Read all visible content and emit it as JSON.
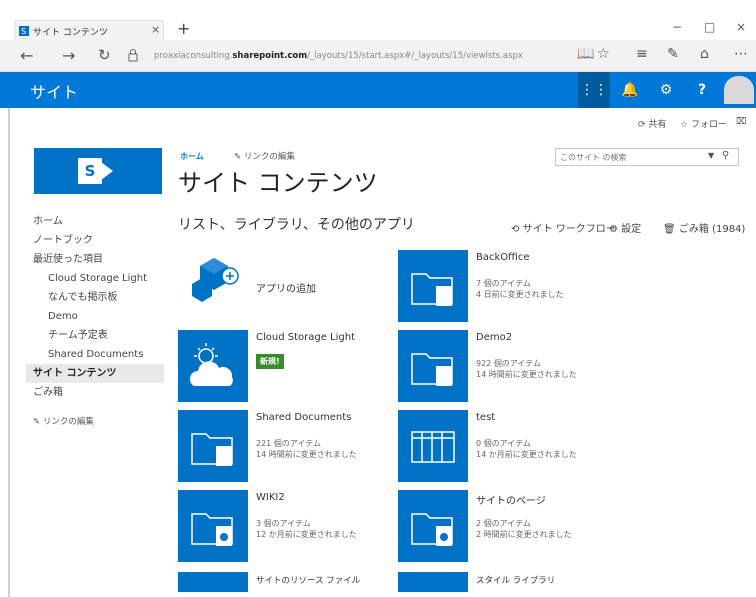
{
  "browser": {
    "tab_title": "サイト コンテンツ",
    "tab_close": "×",
    "new_tab": "+",
    "url_prefix": "proaxiaconsulting.",
    "url_host": "sharepoint.com",
    "url_path": "/_layouts/15/start.aspx#/_layouts/15/viewlsts.aspx",
    "win_minimize": "−",
    "win_maximize": "□",
    "win_close": "×"
  },
  "suitebar": {
    "title": "サイト",
    "help_label": "?"
  },
  "ribbon": {
    "share_label": "共有",
    "follow_label": "フォロー"
  },
  "header": {
    "breadcrumb_home": "ホーム",
    "breadcrumb_edit_links": "リンクの編集",
    "page_title": "サイト コンテンツ",
    "search_placeholder": "このサイト の検索"
  },
  "leftnav": {
    "items": [
      {
        "label": "ホーム"
      },
      {
        "label": "ノートブック"
      },
      {
        "label": "最近使った項目"
      },
      {
        "label": "Cloud Storage Light"
      },
      {
        "label": "なんでも掲示板"
      },
      {
        "label": "Demo"
      },
      {
        "label": "チーム予定表"
      },
      {
        "label": "Shared Documents"
      },
      {
        "label": "サイト コンテンツ"
      },
      {
        "label": "ごみ箱"
      }
    ],
    "edit_links_label": "リンクの編集"
  },
  "section": {
    "title": "リスト、ライブラリ、その他のアプリ",
    "workflow_label": "サイト ワークフロー",
    "settings_label": "設定",
    "recycle_label": "ごみ箱 (1984)"
  },
  "tiles": [
    {
      "name": "アプリの追加",
      "type": "add"
    },
    {
      "name": "BackOffice",
      "count": "7 個のアイテム",
      "modified": "4 日前に変更されました",
      "type": "library"
    },
    {
      "name": "Cloud Storage Light",
      "badge": "新規!",
      "type": "app"
    },
    {
      "name": "Demo2",
      "count": "922 個のアイテム",
      "modified": "14 時間前に変更されました",
      "type": "library"
    },
    {
      "name": "Shared Documents",
      "count": "221 個のアイテム",
      "modified": "14 時間前に変更されました",
      "type": "library"
    },
    {
      "name": "test",
      "count": "0 個のアイテム",
      "modified": "14 か月前に変更されました",
      "type": "list"
    },
    {
      "name": "WIKI2",
      "count": "3 個のアイテム",
      "modified": "12 か月前に変更されました",
      "type": "wiki"
    },
    {
      "name": "サイトのページ",
      "count": "2 個のアイテム",
      "modified": "2 時間前に変更されました",
      "type": "wiki"
    },
    {
      "name": "サイトのリソース ファイル",
      "type": "partial"
    },
    {
      "name": "スタイル ライブラリ",
      "type": "partial"
    }
  ],
  "colors": {
    "suite_blue": "#0078d7",
    "tile_blue": "#0072c6",
    "badge_green": "#3a8a2e"
  }
}
